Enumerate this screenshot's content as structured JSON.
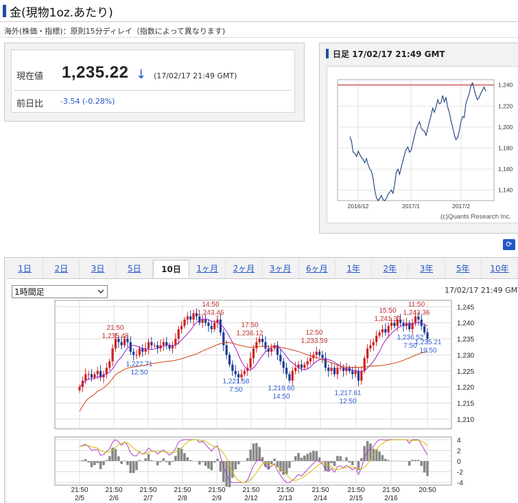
{
  "header": {
    "title": "金(現物1oz.あたり)",
    "note": "海外(株価・指標)：原則15分ディレイ（指数によって異なります)"
  },
  "quote": {
    "price_label": "現在値",
    "price": "1,235.22",
    "price_time": "(17/02/17 21:49 GMT)",
    "prev_label": "前日比",
    "prev_change": "-3.54 (-0.28%)"
  },
  "daily_chart": {
    "title": "日足 17/02/17 21:49 GMT",
    "y_ticks": [
      "1,240",
      "1,220",
      "1,200",
      "1,180",
      "1,160",
      "1,140"
    ],
    "x_ticks": [
      "2016/12",
      "2017/1",
      "2017/2"
    ],
    "credit": "(c)Quants Research Inc.",
    "chart_data": {
      "type": "line",
      "xlabel": "",
      "ylabel": "",
      "ylim": [
        1130,
        1245
      ],
      "reference_line": 1240,
      "values": [
        1191,
        1186,
        1176,
        1175,
        1172,
        1177,
        1174,
        1171,
        1169,
        1166,
        1170,
        1164,
        1160,
        1158,
        1151,
        1140,
        1133,
        1130,
        1132,
        1135,
        1131,
        1130,
        1132,
        1136,
        1138,
        1140,
        1137,
        1145,
        1157,
        1160,
        1155,
        1162,
        1168,
        1174,
        1179,
        1181,
        1176,
        1178,
        1185,
        1192,
        1198,
        1202,
        1205,
        1199,
        1197,
        1196,
        1192,
        1199,
        1205,
        1211,
        1218,
        1214,
        1219,
        1226,
        1222,
        1223,
        1230,
        1224,
        1228,
        1219,
        1214,
        1206,
        1200,
        1193,
        1188,
        1190,
        1196,
        1205,
        1210,
        1209,
        1222,
        1227,
        1232,
        1239,
        1242,
        1236,
        1230,
        1226,
        1228,
        1232,
        1235,
        1238,
        1234
      ]
    }
  },
  "zoom": {
    "icon": "zoom-icon"
  },
  "tabs": [
    "1日",
    "2日",
    "3日",
    "5日",
    "10日",
    "1ヶ月",
    "2ヶ月",
    "3ヶ月",
    "6ヶ月",
    "1年",
    "2年",
    "3年",
    "5年",
    "10年"
  ],
  "active_tab": "10日",
  "interval": {
    "selected": "1時間足"
  },
  "intraday": {
    "timestamp": "17/02/17 21:49 GMT",
    "y_ticks": [
      "1,245",
      "1,240",
      "1,235",
      "1,230",
      "1,225",
      "1,220",
      "1,215",
      "1,210"
    ],
    "osc_ticks": [
      "4",
      "2",
      "0",
      "-2",
      "-4"
    ],
    "x_ticks": [
      {
        "t": "21:50",
        "d": "2/5"
      },
      {
        "t": "21:50",
        "d": "2/6"
      },
      {
        "t": "21:50",
        "d": "2/7"
      },
      {
        "t": "21:50",
        "d": "2/8"
      },
      {
        "t": "21:50",
        "d": "2/9"
      },
      {
        "t": "21:50",
        "d": "2/12"
      },
      {
        "t": "21:50",
        "d": "2/13"
      },
      {
        "t": "21:50",
        "d": "2/14"
      },
      {
        "t": "21:50",
        "d": "2/15"
      },
      {
        "t": "21:50",
        "d": "2/16"
      },
      {
        "t": "20:50",
        "d": ""
      }
    ],
    "annotations": [
      {
        "time": "21:50",
        "value": "1,235.48",
        "kind": "high"
      },
      {
        "time": "12:50",
        "value": "1,227.71",
        "kind": "low"
      },
      {
        "time": "14:50",
        "value": "1,243.46",
        "kind": "high"
      },
      {
        "time": "7:50",
        "value": "1,221.58",
        "kind": "low"
      },
      {
        "time": "17:50",
        "value": "1,236.12",
        "kind": "high"
      },
      {
        "time": "14:50",
        "value": "1,219.60",
        "kind": "low"
      },
      {
        "time": "12:50",
        "value": "1,233.59",
        "kind": "high"
      },
      {
        "time": "12:50",
        "value": "1,217.61",
        "kind": "low"
      },
      {
        "time": "15:50",
        "value": "1,241.33",
        "kind": "high"
      },
      {
        "time": "11:50",
        "value": "1,243.36",
        "kind": "high"
      },
      {
        "time": "7:50",
        "value": "1,236.52",
        "kind": "low"
      },
      {
        "time": "19:50",
        "value": "1,235.21",
        "kind": "low"
      }
    ],
    "colors": {
      "up": "#d02020",
      "down": "#1a3c9a",
      "ma_short": "#9a1ec8",
      "ma_long": "#d04010",
      "osc1": "#b040c0",
      "osc2": "#d0c000",
      "hist": "#888888",
      "high_label": "#c03030",
      "low_label": "#3060d0"
    },
    "chart_data": {
      "type": "candlestick",
      "ylim": [
        1207,
        1247
      ],
      "osc_ylim": [
        -4.5,
        4.5
      ],
      "close": [
        1220,
        1222,
        1224,
        1224,
        1223,
        1224,
        1225,
        1223,
        1224,
        1226,
        1228,
        1232,
        1235,
        1234,
        1233,
        1235,
        1234,
        1231,
        1230,
        1230,
        1232,
        1231,
        1232,
        1234,
        1233,
        1233,
        1232,
        1233,
        1234,
        1233,
        1232,
        1233,
        1235,
        1238,
        1239,
        1241,
        1242,
        1241,
        1243,
        1242,
        1240,
        1241,
        1240,
        1239,
        1238,
        1240,
        1241,
        1237,
        1233,
        1230,
        1227,
        1225,
        1224,
        1223,
        1224,
        1225,
        1226,
        1229,
        1232,
        1234,
        1235,
        1234,
        1232,
        1231,
        1232,
        1233,
        1230,
        1228,
        1226,
        1224,
        1222,
        1225,
        1226,
        1227,
        1226,
        1227,
        1228,
        1229,
        1230,
        1231,
        1230,
        1229,
        1226,
        1225,
        1226,
        1224,
        1226,
        1226,
        1225,
        1226,
        1225,
        1224,
        1225,
        1222,
        1225,
        1229,
        1232,
        1233,
        1234,
        1236,
        1237,
        1238,
        1237,
        1239,
        1240,
        1239,
        1241,
        1240,
        1239,
        1240,
        1238,
        1240,
        1242,
        1241,
        1239,
        1237,
        1235
      ]
    }
  }
}
